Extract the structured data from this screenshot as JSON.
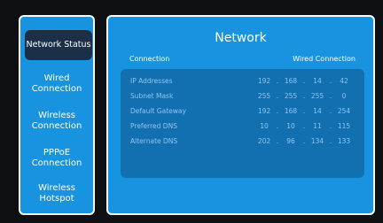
{
  "sidebar": {
    "items": [
      {
        "label": "Network Status"
      },
      {
        "label": "Wired\nConnection"
      },
      {
        "label": "Wireless\nConnection"
      },
      {
        "label": "PPPoE\nConnection"
      },
      {
        "label": "Wireless\nHotspot"
      }
    ]
  },
  "main": {
    "title": "Network",
    "header_left": "Connection",
    "header_right": "Wired Connection",
    "rows": [
      {
        "label": "IP Addresses",
        "octets": [
          "192",
          "168",
          "14",
          "42"
        ]
      },
      {
        "label": "Subnet Mask",
        "octets": [
          "255",
          "255",
          "255",
          "0"
        ]
      },
      {
        "label": "Default Gateway",
        "octets": [
          "192",
          "168",
          "14",
          "254"
        ]
      },
      {
        "label": "Preferred DNS",
        "octets": [
          "10",
          "10",
          "11",
          "115"
        ]
      },
      {
        "label": "Alternate DNS",
        "octets": [
          "202",
          "96",
          "134",
          "133"
        ]
      }
    ],
    "separator": "."
  },
  "colors": {
    "panel": "#1893df",
    "active_item": "#1b2f49",
    "table": "#126fb0",
    "background": "#0e0f12"
  }
}
